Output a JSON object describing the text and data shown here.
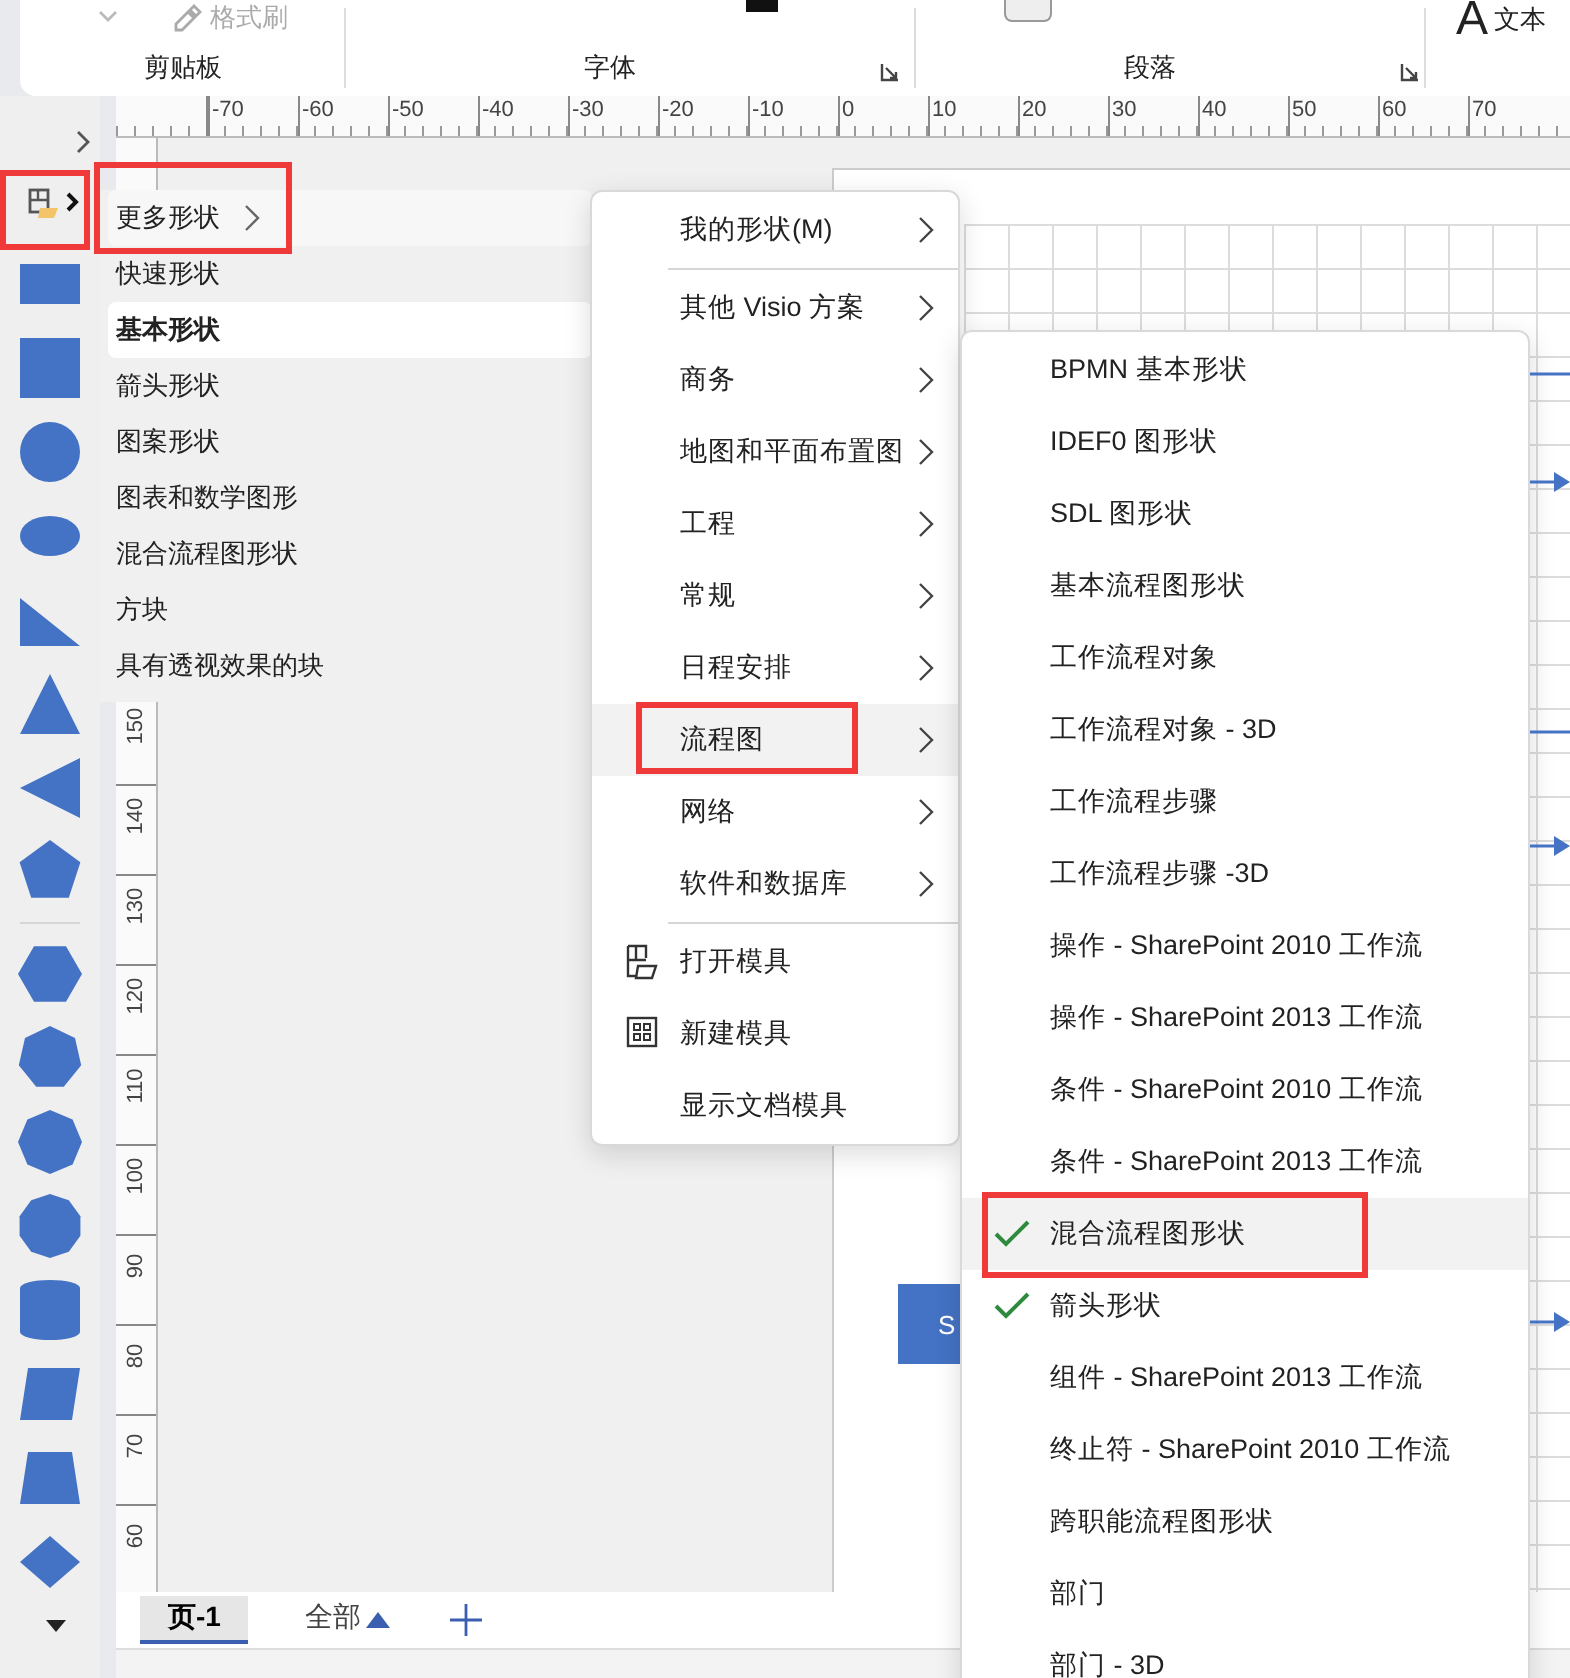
{
  "ribbon": {
    "format_painter": {
      "label": "格式刷",
      "disabled": true
    },
    "groups": [
      {
        "label": "剪贴板",
        "launcher": false
      },
      {
        "label": "字体",
        "launcher": true
      },
      {
        "label": "段落",
        "launcher": true
      }
    ],
    "text_tool": {
      "glyph": "A",
      "label": "文本"
    }
  },
  "ruler": {
    "horizontal": [
      "-70",
      "-60",
      "-50",
      "-40",
      "-30",
      "-20",
      "-10",
      "0",
      "10",
      "20",
      "30",
      "40",
      "50",
      "60",
      "70"
    ],
    "vertical": [
      "150",
      "140",
      "130",
      "120",
      "110",
      "100",
      "90",
      "80",
      "70",
      "60"
    ]
  },
  "shapes_panel": {
    "stencil_toggle": {
      "annotated": true
    },
    "shapes": [
      {
        "kind": "rectangle"
      },
      {
        "kind": "square"
      },
      {
        "kind": "circle"
      },
      {
        "kind": "ellipse"
      },
      {
        "kind": "right-triangle"
      },
      {
        "kind": "triangle-up"
      },
      {
        "kind": "triangle-left"
      },
      {
        "kind": "pentagon"
      },
      {
        "kind": "separator"
      },
      {
        "kind": "hexagon"
      },
      {
        "kind": "heptagon"
      },
      {
        "kind": "octagon"
      },
      {
        "kind": "decagon"
      },
      {
        "kind": "cylinder"
      },
      {
        "kind": "parallelogram"
      },
      {
        "kind": "trapezoid"
      },
      {
        "kind": "diamond"
      }
    ]
  },
  "stencil_list": [
    {
      "label": "更多形状",
      "submenu": true,
      "selected": false,
      "annotated": true
    },
    {
      "label": "快速形状",
      "submenu": false,
      "selected": false,
      "annotated": false
    },
    {
      "label": "基本形状",
      "submenu": false,
      "selected": true,
      "annotated": false
    },
    {
      "label": "箭头形状",
      "submenu": false,
      "selected": false,
      "annotated": false
    },
    {
      "label": "图案形状",
      "submenu": false,
      "selected": false,
      "annotated": false
    },
    {
      "label": "图表和数学图形",
      "submenu": false,
      "selected": false,
      "annotated": false
    },
    {
      "label": "混合流程图形状",
      "submenu": false,
      "selected": false,
      "annotated": false
    },
    {
      "label": "方块",
      "submenu": false,
      "selected": false,
      "annotated": false
    },
    {
      "label": "具有透视效果的块",
      "submenu": false,
      "selected": false,
      "annotated": false
    }
  ],
  "canvas": {
    "shape_text": "S"
  },
  "more_shapes_menu": [
    {
      "label": "我的形状(M)",
      "submenu": true,
      "separator_after": true,
      "hovered": false,
      "annotated": false
    },
    {
      "label": "其他 Visio 方案",
      "submenu": true,
      "separator_after": false,
      "hovered": false,
      "annotated": false
    },
    {
      "label": "商务",
      "submenu": true,
      "separator_after": false,
      "hovered": false,
      "annotated": false
    },
    {
      "label": "地图和平面布置图",
      "submenu": true,
      "separator_after": false,
      "hovered": false,
      "annotated": false
    },
    {
      "label": "工程",
      "submenu": true,
      "separator_after": false,
      "hovered": false,
      "annotated": false
    },
    {
      "label": "常规",
      "submenu": true,
      "separator_after": false,
      "hovered": false,
      "annotated": false
    },
    {
      "label": "日程安排",
      "submenu": true,
      "separator_after": false,
      "hovered": false,
      "annotated": false
    },
    {
      "label": "流程图",
      "submenu": true,
      "separator_after": false,
      "hovered": true,
      "annotated": true
    },
    {
      "label": "网络",
      "submenu": true,
      "separator_after": false,
      "hovered": false,
      "annotated": false
    },
    {
      "label": "软件和数据库",
      "submenu": true,
      "separator_after": true,
      "hovered": false,
      "annotated": false
    },
    {
      "label": "打开模具",
      "submenu": false,
      "kind": "open",
      "separator_after": false,
      "hovered": false,
      "annotated": false
    },
    {
      "label": "新建模具",
      "submenu": false,
      "kind": "new",
      "separator_after": false,
      "hovered": false,
      "annotated": false
    },
    {
      "label": "显示文档模具",
      "submenu": false,
      "separator_after": false,
      "hovered": false,
      "annotated": false
    }
  ],
  "flowchart_menu": [
    {
      "label": "BPMN 基本形状",
      "checked": false,
      "hovered": false,
      "annotated": false
    },
    {
      "label": "IDEF0 图形状",
      "checked": false,
      "hovered": false,
      "annotated": false
    },
    {
      "label": "SDL 图形状",
      "checked": false,
      "hovered": false,
      "annotated": false
    },
    {
      "label": "基本流程图形状",
      "checked": false,
      "hovered": false,
      "annotated": false
    },
    {
      "label": "工作流程对象",
      "checked": false,
      "hovered": false,
      "annotated": false
    },
    {
      "label": "工作流程对象 - 3D",
      "checked": false,
      "hovered": false,
      "annotated": false
    },
    {
      "label": "工作流程步骤",
      "checked": false,
      "hovered": false,
      "annotated": false
    },
    {
      "label": "工作流程步骤 -3D",
      "checked": false,
      "hovered": false,
      "annotated": false
    },
    {
      "label": "操作 - SharePoint 2010 工作流",
      "checked": false,
      "hovered": false,
      "annotated": false
    },
    {
      "label": "操作 - SharePoint 2013 工作流",
      "checked": false,
      "hovered": false,
      "annotated": false
    },
    {
      "label": "条件 - SharePoint 2010 工作流",
      "checked": false,
      "hovered": false,
      "annotated": false
    },
    {
      "label": "条件 - SharePoint 2013 工作流",
      "checked": false,
      "hovered": false,
      "annotated": false
    },
    {
      "label": "混合流程图形状",
      "checked": true,
      "hovered": true,
      "annotated": true
    },
    {
      "label": "箭头形状",
      "checked": true,
      "hovered": false,
      "annotated": false
    },
    {
      "label": "组件 - SharePoint 2013 工作流",
      "checked": false,
      "hovered": false,
      "annotated": false
    },
    {
      "label": "终止符 - SharePoint 2010 工作流",
      "checked": false,
      "hovered": false,
      "annotated": false
    },
    {
      "label": "跨职能流程图形状",
      "checked": false,
      "hovered": false,
      "annotated": false
    },
    {
      "label": "部门",
      "checked": false,
      "hovered": false,
      "annotated": false
    },
    {
      "label": "部门 - 3D",
      "checked": false,
      "hovered": false,
      "annotated": false
    }
  ],
  "page_tabs": [
    {
      "kind": "page",
      "label": "页-1",
      "selected": true
    },
    {
      "kind": "all",
      "label": "全部",
      "selected": false
    },
    {
      "kind": "add"
    }
  ]
}
